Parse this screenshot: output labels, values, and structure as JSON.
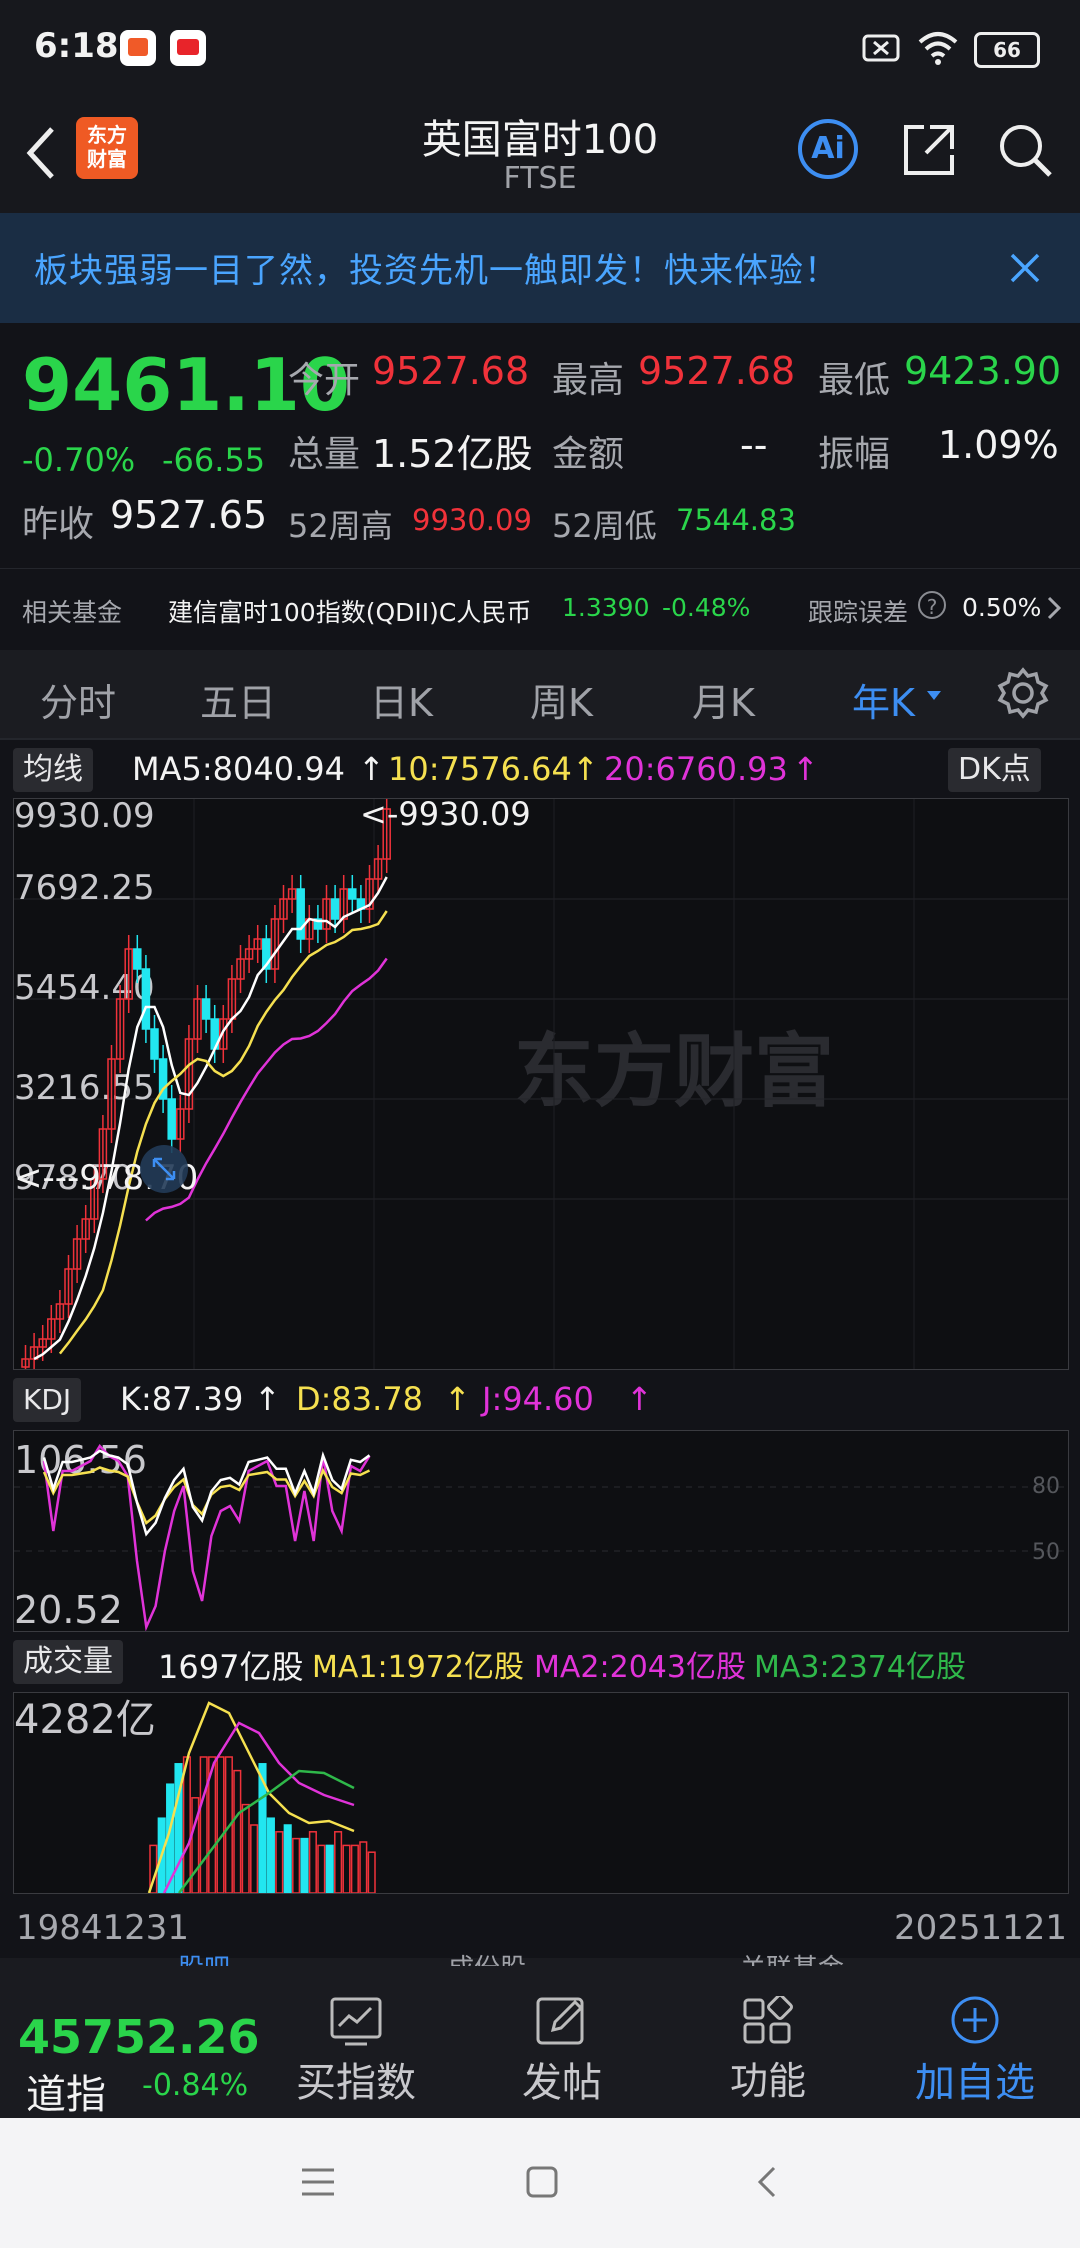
{
  "status": {
    "time": "6:18",
    "battery": "66"
  },
  "header": {
    "title": "英国富时100",
    "subtitle": "FTSE",
    "logo_line1": "东方",
    "logo_line2": "财富",
    "ai_label": "Ai"
  },
  "banner": {
    "text": "板块强弱一目了然，投资先机一触即发！快来体验！"
  },
  "quote": {
    "price": "9461.10",
    "change_pct": "-0.70%",
    "change": "-66.55",
    "open_label": "今开",
    "open": "9527.68",
    "high_label": "最高",
    "high": "9527.68",
    "low_label": "最低",
    "low": "9423.90",
    "volume_label": "总量",
    "volume": "1.52亿股",
    "amount_label": "金额",
    "amount": "--",
    "amplitude_label": "振幅",
    "amplitude": "1.09%",
    "prev_close_label": "昨收",
    "prev_close": "9527.65",
    "w52_high_label": "52周高",
    "w52_high": "9930.09",
    "w52_low_label": "52周低",
    "w52_low": "7544.83"
  },
  "fund": {
    "label": "相关基金",
    "name": "建信富时100指数(QDII)C人民币",
    "nav": "1.3390",
    "change": "-0.48%",
    "tracking_label": "跟踪误差",
    "tracking": "0.50%"
  },
  "tabs": {
    "items": [
      "分时",
      "五日",
      "日K",
      "周K",
      "月K",
      "年K"
    ],
    "active": "年K"
  },
  "main_chart": {
    "ma_tag": "均线",
    "ma5": "MA5:8040.94",
    "ma10": "10:7576.64",
    "ma20": "20:6760.93",
    "dk_tag": "DK点",
    "y_labels": [
      "9930.09",
      "7692.25",
      "5454.40",
      "3216.55",
      "978.70"
    ],
    "max_marker": "<-9930.09",
    "min_marker": "<---978.70",
    "watermark": "东方财富"
  },
  "kdj": {
    "tag": "KDJ",
    "k": "K:87.39",
    "d": "D:83.78",
    "j": "J:94.60",
    "y_top": "106.56",
    "y_bottom": "20.52",
    "level_80": "80",
    "level_50": "50"
  },
  "volume": {
    "tag": "成交量",
    "value": "1697亿股",
    "ma1": "MA1:1972亿股",
    "ma2": "MA2:2043亿股",
    "ma3": "MA3:2374亿股",
    "y_top": "4282亿",
    "date_start": "19841231",
    "date_end": "20251121"
  },
  "bottom_nav": {
    "tabs_peek": [
      "股吧",
      "成份股",
      "关联基金"
    ],
    "index_name": "道指",
    "index_value": "45752.26",
    "index_change": "-0.84%",
    "items": [
      "买指数",
      "发帖",
      "功能",
      "加自选"
    ]
  },
  "colors": {
    "up": "#f0323a",
    "down": "#2ad54b",
    "accent": "#3d8ef2",
    "ma5": "#ffffff",
    "ma10": "#f5e050",
    "ma20": "#e033d8",
    "volume_down": "#22e6f0"
  }
}
